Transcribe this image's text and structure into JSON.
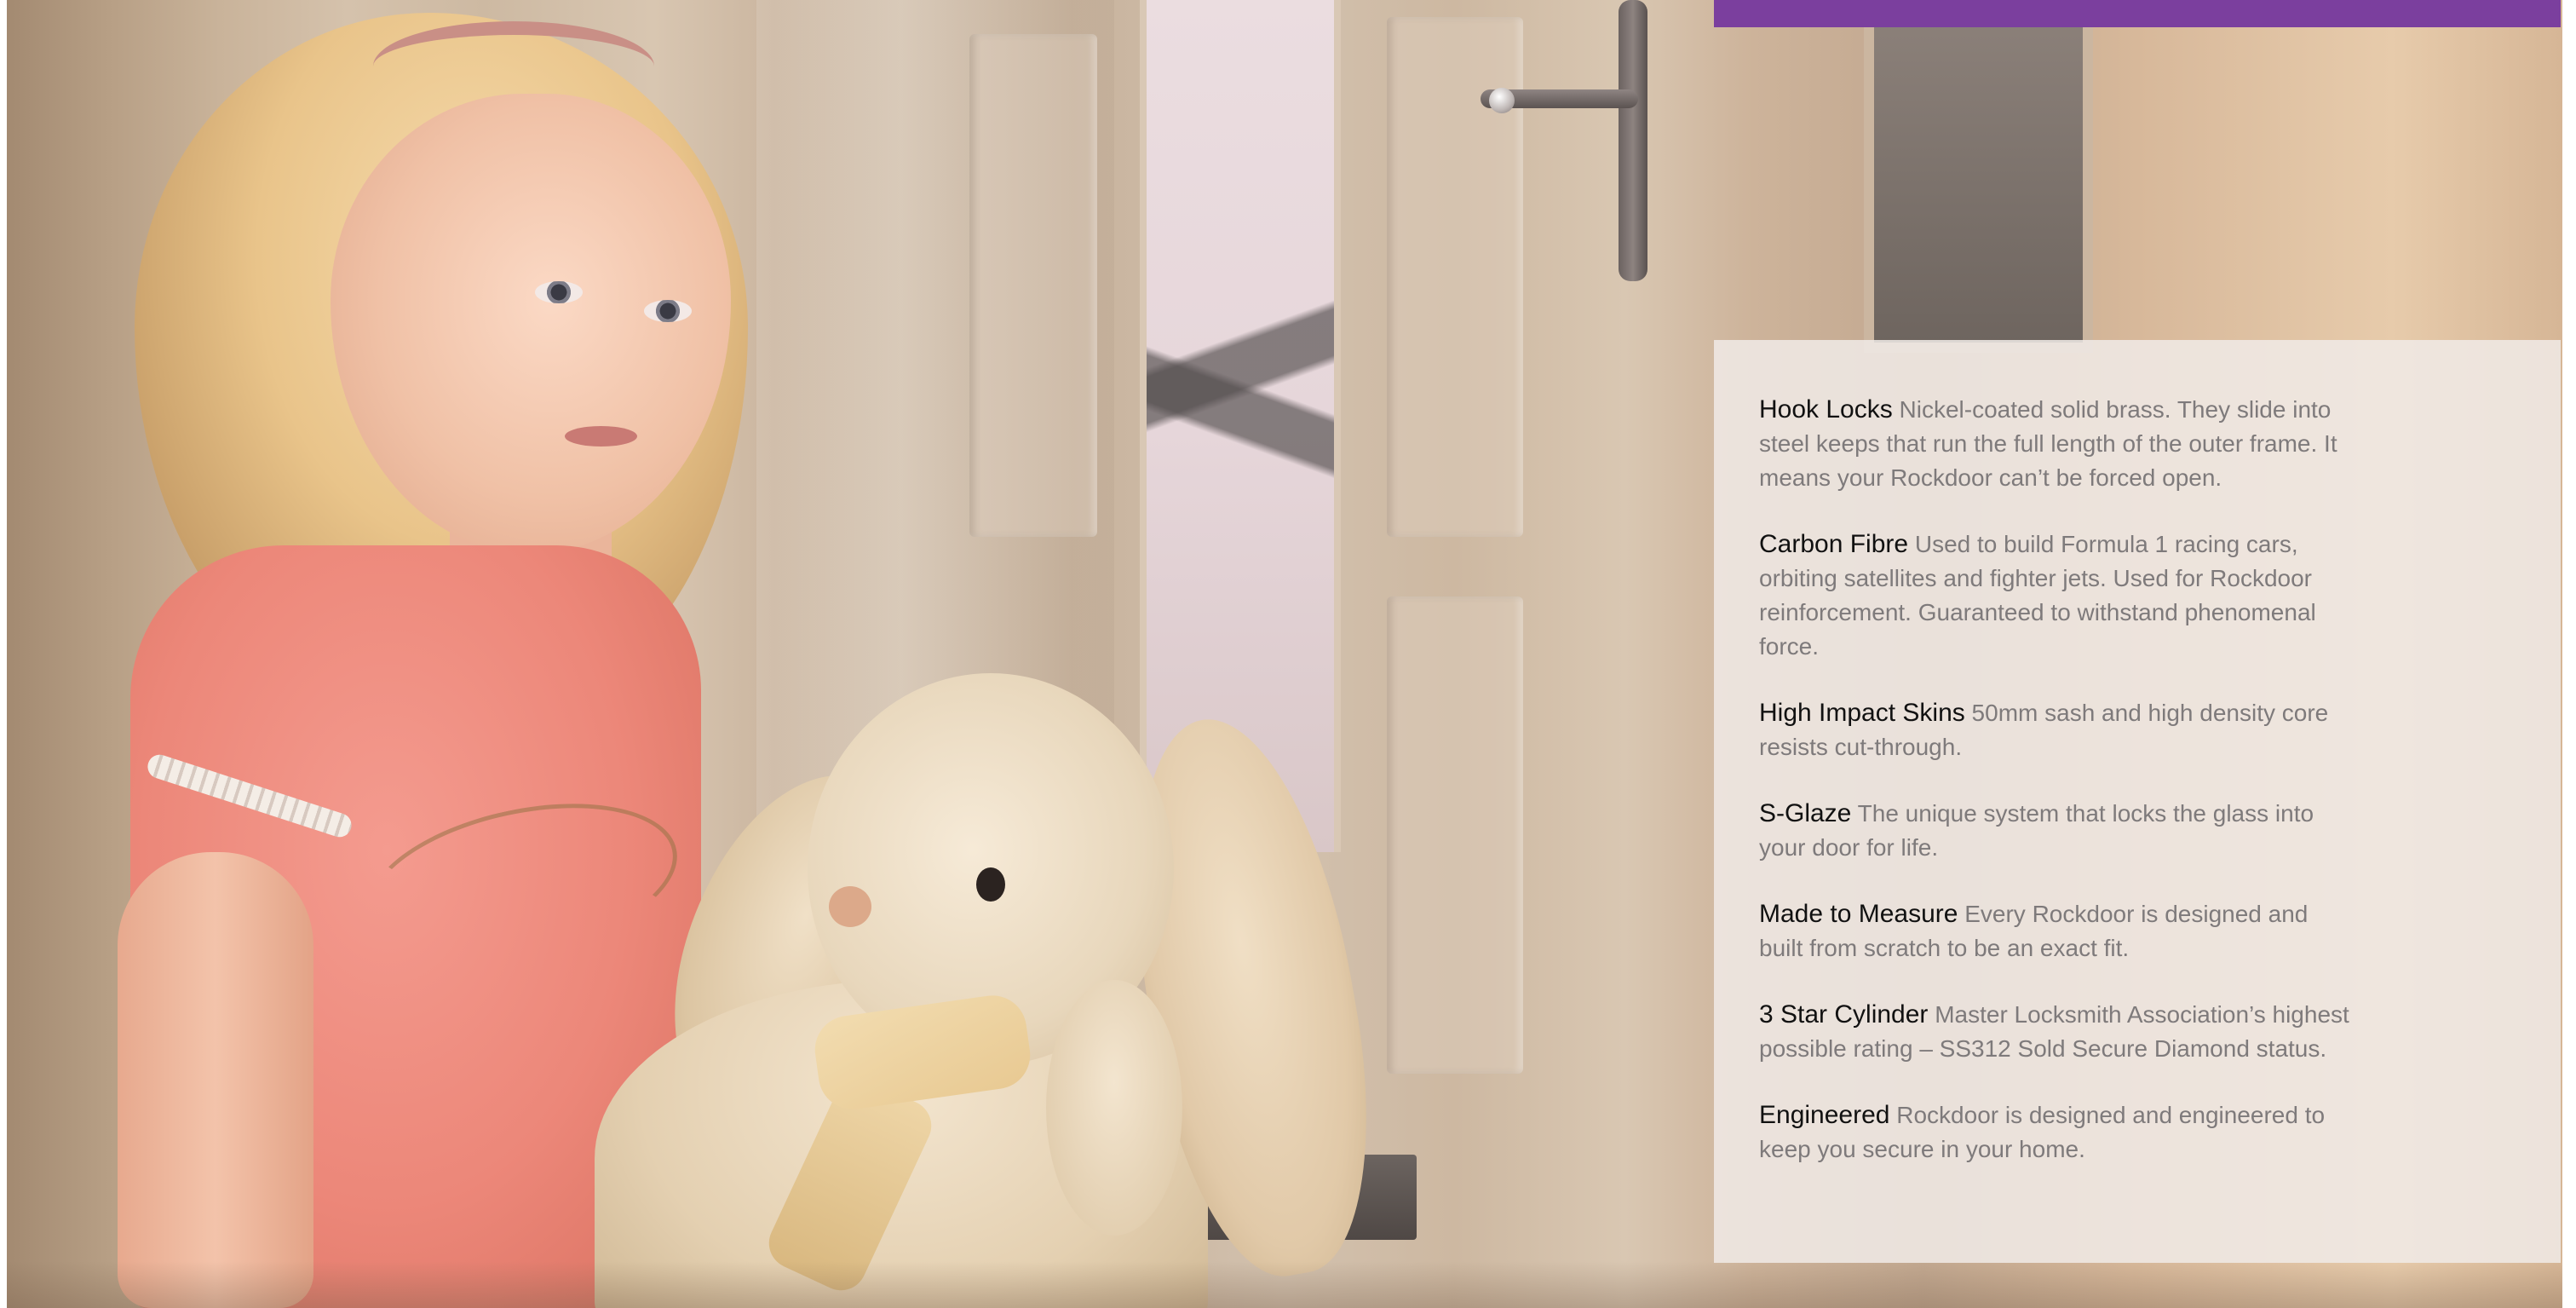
{
  "colors": {
    "accent_bar": "#7b3f9e",
    "panel_background": "rgba(240,234,230,0.86)",
    "title_text": "#111111",
    "body_text": "#7e7a7b"
  },
  "hero": {
    "description_icon": "photo-girl-with-bunny"
  },
  "features": [
    {
      "title": "Hook Locks",
      "description": "Nickel-coated solid brass. They slide into steel keeps that run the full length of the outer frame. It means your Rockdoor can’t be forced open."
    },
    {
      "title": "Carbon Fibre",
      "description": "Used to build Formula 1 racing cars, orbiting satellites and fighter jets. Used for Rockdoor reinforcement. Guaranteed to withstand phenomenal force."
    },
    {
      "title": "High Impact Skins",
      "description": "50mm sash and high density core resists cut-through."
    },
    {
      "title": "S-Glaze",
      "description": "The unique system that locks the glass into your door for life."
    },
    {
      "title": "Made to Measure",
      "description": "Every Rockdoor is designed and built from scratch to be an exact fit."
    },
    {
      "title": "3 Star Cylinder",
      "description": "Master Locksmith Association’s highest possible rating – SS312 Sold Secure Diamond status."
    },
    {
      "title": "Engineered",
      "description": "Rockdoor is designed and engineered to keep you secure in your home."
    }
  ]
}
